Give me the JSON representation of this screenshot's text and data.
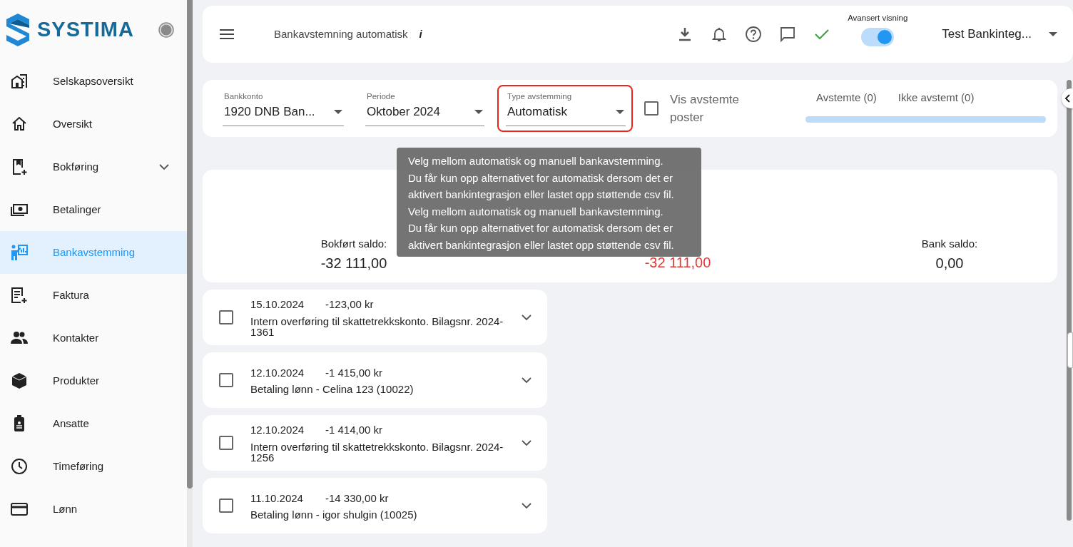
{
  "sidebar": {
    "brand": "SYSTIMA",
    "items": [
      {
        "label": "Selskapsoversikt",
        "selected": false,
        "expandable": false
      },
      {
        "label": "Oversikt",
        "selected": false,
        "expandable": false
      },
      {
        "label": "Bokføring",
        "selected": false,
        "expandable": true
      },
      {
        "label": "Betalinger",
        "selected": false,
        "expandable": false
      },
      {
        "label": "Bankavstemming",
        "selected": true,
        "expandable": false
      },
      {
        "label": "Faktura",
        "selected": false,
        "expandable": false
      },
      {
        "label": "Kontakter",
        "selected": false,
        "expandable": false
      },
      {
        "label": "Produkter",
        "selected": false,
        "expandable": false
      },
      {
        "label": "Ansatte",
        "selected": false,
        "expandable": false
      },
      {
        "label": "Timeføring",
        "selected": false,
        "expandable": false
      },
      {
        "label": "Lønn",
        "selected": false,
        "expandable": false
      }
    ]
  },
  "header": {
    "title": "Bankavstemning automatisk",
    "info": "i",
    "advanced_view": {
      "label": "Avansert visning",
      "on": true
    },
    "company": "Test Bankinteg..."
  },
  "filters": {
    "fields": [
      {
        "label": "Bankkonto",
        "value": "1920 DNB Ban...",
        "highlighted": false
      },
      {
        "label": "Periode",
        "value": "Oktober 2024",
        "highlighted": false
      },
      {
        "label": "Type avstemming",
        "value": "Automatisk",
        "highlighted": true
      }
    ],
    "show_reconciled": {
      "label": "Vis avstemte poster",
      "checked": false
    },
    "tabs": [
      {
        "label": "Avstemte (0)"
      },
      {
        "label": "Ikke avstemt (0)"
      }
    ],
    "progress": {
      "level": 1
    }
  },
  "summary": {
    "balances": [
      {
        "label": "Bokført saldo:",
        "value": "-32 111,00",
        "negative": false
      },
      {
        "value": "-32 111,00",
        "negative": true
      },
      {
        "label": "Bank saldo:",
        "value": "0,00",
        "negative": false
      }
    ]
  },
  "tooltip": {
    "lines": [
      "Velg mellom automatisk og manuell bankavstemming.",
      "Du får kun opp alternativet for automatisk dersom det er",
      "aktivert bankintegrasjon eller lastet opp støttende csv fil.",
      "Velg mellom automatisk og manuell bankavstemming.",
      "Du får kun opp alternativet for automatisk dersom det er",
      "aktivert bankintegrasjon eller lastet opp støttende csv fil."
    ]
  },
  "transactions": [
    {
      "date": "15.10.2024",
      "amount": "-123,00 kr",
      "description": "Intern overføring til skattetrekkskonto. Bilagsnr. 2024-1361",
      "checked": false
    },
    {
      "date": "12.10.2024",
      "amount": "-1 415,00 kr",
      "description": "Betaling lønn - Celina 123 (10022)",
      "checked": false
    },
    {
      "date": "12.10.2024",
      "amount": "-1 414,00 kr",
      "description": "Intern overføring til skattetrekkskonto. Bilagsnr. 2024-1256",
      "checked": false
    },
    {
      "date": "11.10.2024",
      "amount": "-14 330,00 kr",
      "description": "Betaling lønn - igor shulgin (10025)",
      "checked": false
    }
  ]
}
